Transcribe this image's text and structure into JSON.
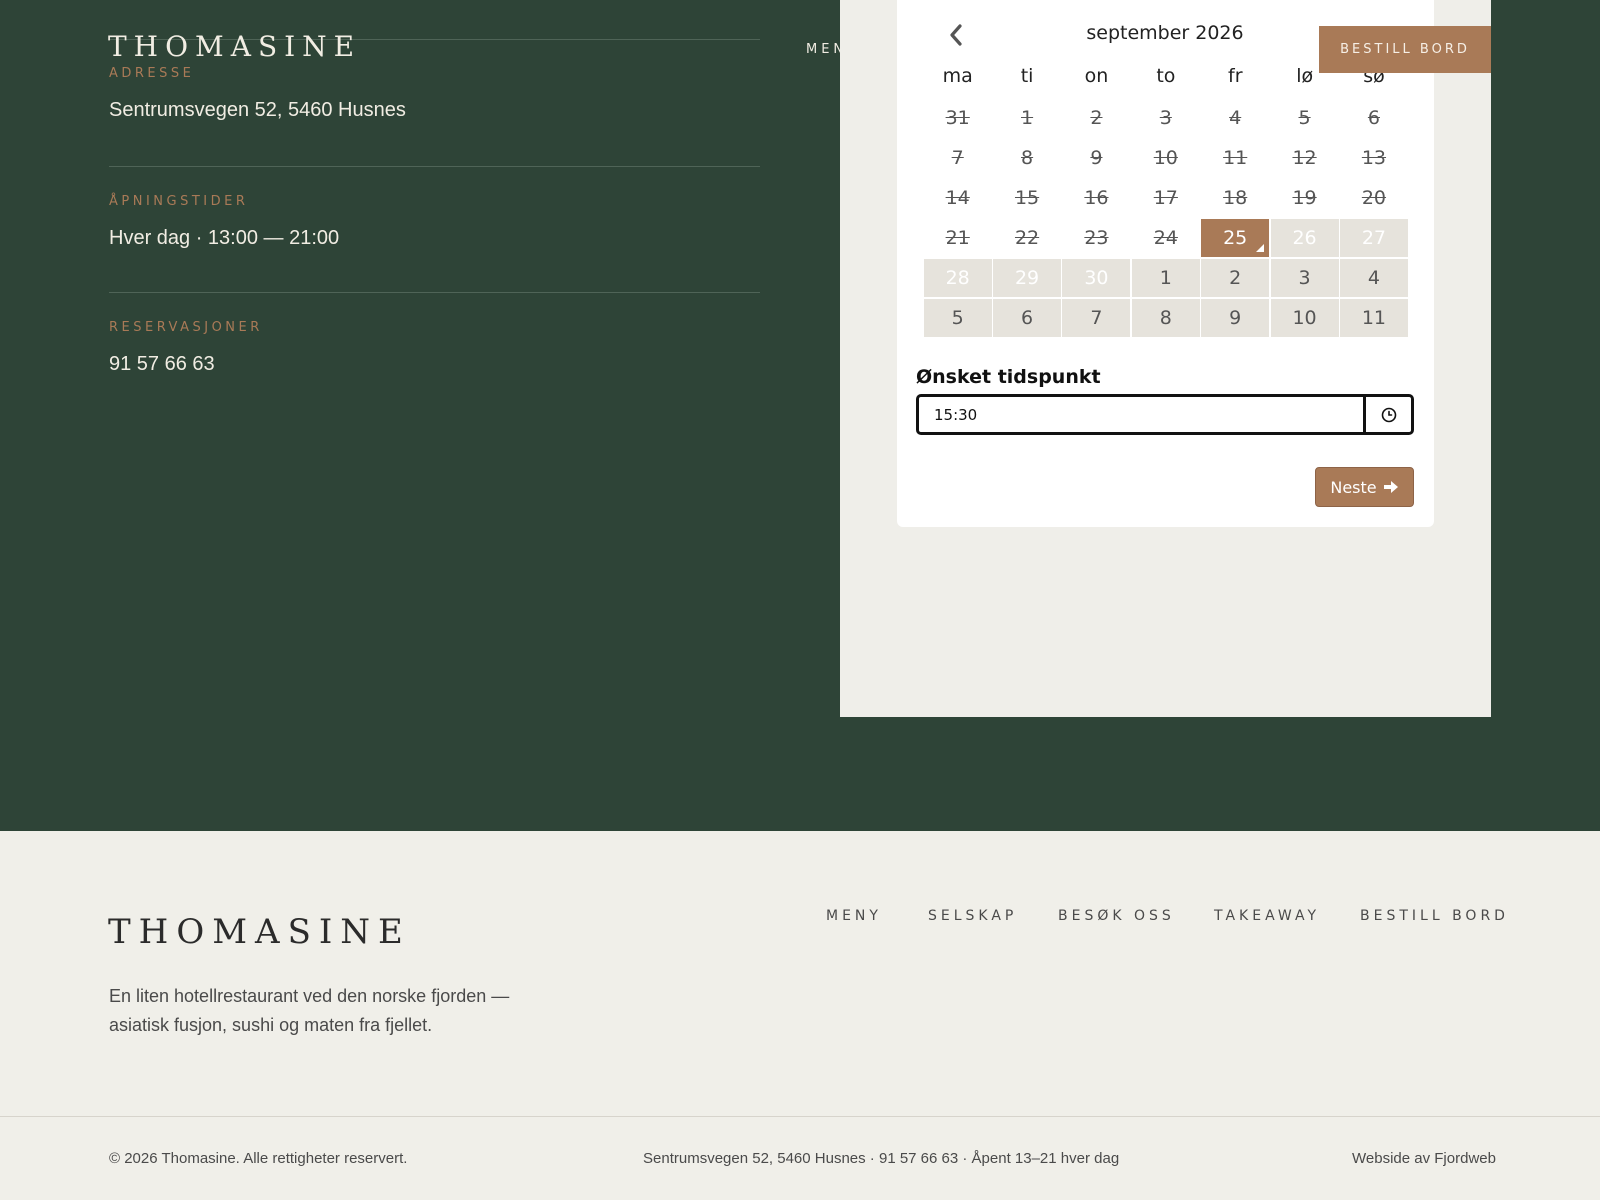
{
  "brand": {
    "name": "THOMASINE"
  },
  "nav": {
    "items": [
      "MENY",
      "SELSKAP",
      "BESØK OSS",
      "TAKEAWAY"
    ],
    "cta": "BESTILL BORD"
  },
  "info": {
    "address_label": "ADRESSE",
    "address_value": "Sentrumsvegen 52, 5460 Husnes",
    "hours_label": "ÅPNINGSTIDER",
    "hours_value": "Hver dag · 13:00 — 21:00",
    "reservations_label": "RESERVASJONER",
    "reservations_value": "91 57 66 63"
  },
  "calendar": {
    "month_title": "september 2026",
    "weekdays": [
      "ma",
      "ti",
      "on",
      "to",
      "fr",
      "lø",
      "sø"
    ],
    "weeks": [
      [
        {
          "d": "31",
          "s": "disabled"
        },
        {
          "d": "1",
          "s": "disabled"
        },
        {
          "d": "2",
          "s": "disabled"
        },
        {
          "d": "3",
          "s": "disabled"
        },
        {
          "d": "4",
          "s": "disabled"
        },
        {
          "d": "5",
          "s": "disabled"
        },
        {
          "d": "6",
          "s": "disabled"
        }
      ],
      [
        {
          "d": "7",
          "s": "disabled"
        },
        {
          "d": "8",
          "s": "disabled"
        },
        {
          "d": "9",
          "s": "disabled"
        },
        {
          "d": "10",
          "s": "disabled"
        },
        {
          "d": "11",
          "s": "disabled"
        },
        {
          "d": "12",
          "s": "disabled"
        },
        {
          "d": "13",
          "s": "disabled"
        }
      ],
      [
        {
          "d": "14",
          "s": "disabled"
        },
        {
          "d": "15",
          "s": "disabled"
        },
        {
          "d": "16",
          "s": "disabled"
        },
        {
          "d": "17",
          "s": "disabled"
        },
        {
          "d": "18",
          "s": "disabled"
        },
        {
          "d": "19",
          "s": "disabled"
        },
        {
          "d": "20",
          "s": "disabled"
        }
      ],
      [
        {
          "d": "21",
          "s": "disabled"
        },
        {
          "d": "22",
          "s": "disabled"
        },
        {
          "d": "23",
          "s": "disabled"
        },
        {
          "d": "24",
          "s": "disabled"
        },
        {
          "d": "25",
          "s": "selected"
        },
        {
          "d": "26",
          "s": "avail-dim"
        },
        {
          "d": "27",
          "s": "avail-dim"
        }
      ],
      [
        {
          "d": "28",
          "s": "avail-dim"
        },
        {
          "d": "29",
          "s": "avail-dim"
        },
        {
          "d": "30",
          "s": "avail-dim"
        },
        {
          "d": "1",
          "s": "avail"
        },
        {
          "d": "2",
          "s": "avail"
        },
        {
          "d": "3",
          "s": "avail"
        },
        {
          "d": "4",
          "s": "avail"
        }
      ],
      [
        {
          "d": "5",
          "s": "avail"
        },
        {
          "d": "6",
          "s": "avail"
        },
        {
          "d": "7",
          "s": "avail"
        },
        {
          "d": "8",
          "s": "avail"
        },
        {
          "d": "9",
          "s": "avail"
        },
        {
          "d": "10",
          "s": "avail"
        },
        {
          "d": "11",
          "s": "avail"
        }
      ]
    ]
  },
  "booking": {
    "time_label": "Ønsket tidspunkt",
    "time_value": "15:30",
    "next_label": "Neste"
  },
  "footer": {
    "brand": "THOMASINE",
    "description": "En liten hotellrestaurant ved den norske fjorden — asiatisk fusjon, sushi og maten fra fjellet.",
    "nav": [
      "MENY",
      "SELSKAP",
      "BESØK OSS",
      "TAKEAWAY",
      "BESTILL BORD"
    ],
    "copyright": "© 2026 Thomasine. Alle rettigheter reservert.",
    "contact_line": "Sentrumsvegen 52, 5460 Husnes · 91 57 66 63 · Åpent 13–21 hver dag",
    "credit": "Webside av Fjordweb"
  },
  "colors": {
    "dark_green": "#2e4437",
    "accent_brown": "#a97a57",
    "cream": "#f0efe9"
  }
}
